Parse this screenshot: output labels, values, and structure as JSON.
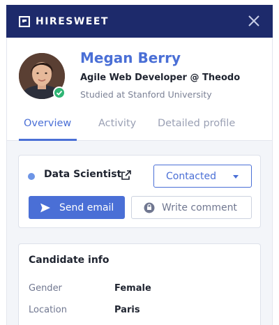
{
  "app": {
    "brand": "HIRESWEET"
  },
  "icons": {
    "logo": "hiresweet-logo",
    "close": "close-icon",
    "verified": "check-icon",
    "external": "external-link-icon",
    "send": "send-icon",
    "comment": "comment-icon",
    "caret": "chevron-down-icon"
  },
  "colors": {
    "header_bg": "#1d2a6b",
    "accent": "#4a6fd6",
    "verified": "#2fb574",
    "content_bg": "#f3f5f9"
  },
  "profile": {
    "name": "Megan Berry",
    "headline": "Agile Web Developer @ Theodo",
    "education": "Studied at Stanford University"
  },
  "tabs": [
    {
      "label": "Overview",
      "active": true
    },
    {
      "label": "Activity",
      "active": false
    },
    {
      "label": "Detailed profile",
      "active": false
    }
  ],
  "job": {
    "title": "Data Scientist",
    "status": "Contacted"
  },
  "actions": {
    "send_email": "Send email",
    "write_comment": "Write comment"
  },
  "candidate_info": {
    "title": "Candidate info",
    "rows": [
      {
        "label": "Gender",
        "value": "Female"
      },
      {
        "label": "Location",
        "value": "Paris"
      }
    ]
  }
}
